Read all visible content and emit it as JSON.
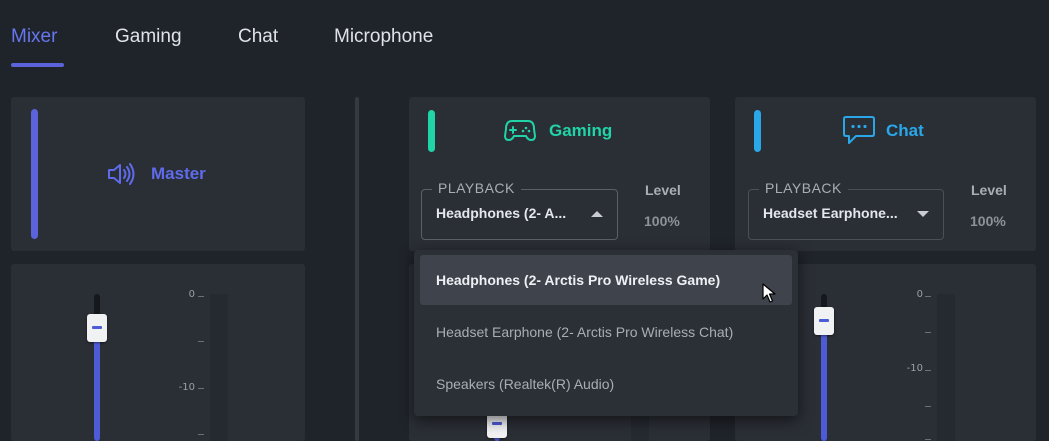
{
  "tabs": [
    {
      "label": "Mixer",
      "active": true
    },
    {
      "label": "Gaming",
      "active": false
    },
    {
      "label": "Chat",
      "active": false
    },
    {
      "label": "Microphone",
      "active": false
    }
  ],
  "master": {
    "title": "Master",
    "icon": "speaker-icon",
    "accent": "#5a63d9",
    "ticks": [
      "0",
      "-10"
    ]
  },
  "gaming": {
    "title": "Gaming",
    "icon": "gamepad-icon",
    "accent": "#20d4a8",
    "playback_legend": "PLAYBACK",
    "playback_value": "Headphones (2- Arctis Pro Wireless Game)",
    "playback_value_display": "Headphones (2- A...",
    "level_label": "Level",
    "level_value": "100%"
  },
  "chat": {
    "title": "Chat",
    "icon": "chat-bubble-icon",
    "accent": "#2aa7e8",
    "playback_legend": "PLAYBACK",
    "playback_value_display": "Headset Earphone...",
    "level_label": "Level",
    "level_value": "100%",
    "ticks": [
      "0",
      "-10"
    ]
  },
  "dropdown": {
    "options": [
      "Headphones (2- Arctis Pro Wireless Game)",
      "Headset Earphone (2- Arctis Pro Wireless Chat)",
      "Speakers (Realtek(R) Audio)"
    ],
    "selected_index": 0
  },
  "colors": {
    "background": "#1f232a",
    "panel": "#2a2e35",
    "tab_active": "#6677f0",
    "slider_fill": "#4d5bd6"
  }
}
